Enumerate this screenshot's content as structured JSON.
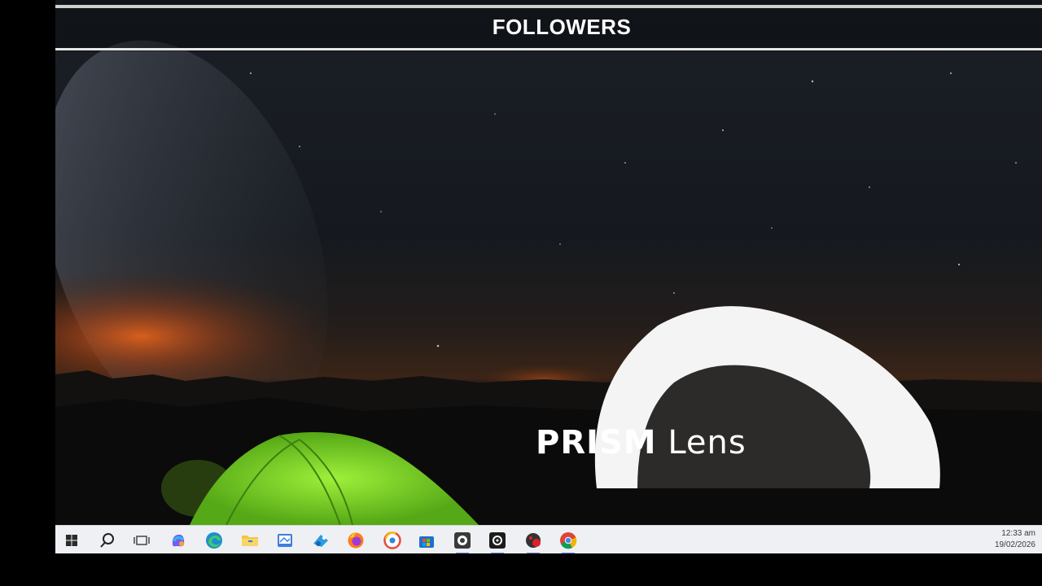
{
  "header": {
    "title": "FOLLOWERS"
  },
  "overlay": {
    "brand_strong": "PRISM",
    "brand_light": " Lens"
  },
  "taskbar": {
    "icons": [
      "windows-start-icon",
      "search-icon",
      "task-view-icon",
      "copilot-icon",
      "edge-icon",
      "file-explorer-icon",
      "app-icon",
      "app-icon",
      "firefox-icon",
      "app-icon",
      "store-icon",
      "app-icon",
      "app-icon",
      "app-icon",
      "chrome-icon"
    ],
    "time": "12:33 am",
    "date": "19/02/2026"
  },
  "colors": {
    "tent": "#7ddc2a",
    "horizon_glow": "#e0611c",
    "sky": "#141922",
    "taskbar": "#eef0f3"
  }
}
